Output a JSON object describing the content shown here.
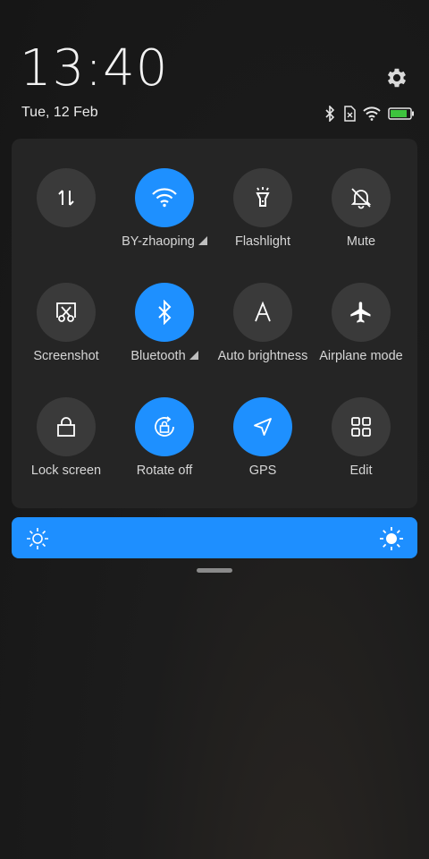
{
  "clock": {
    "time": "13:40",
    "date": "Tue, 12 Feb"
  },
  "colors": {
    "accent": "#1e90ff",
    "tile_off": "#3a3a3a",
    "panel": "#262626"
  },
  "status_icons": [
    "bluetooth-icon",
    "no-sim-icon",
    "wifi-icon",
    "battery-icon"
  ],
  "tiles": [
    {
      "label": "",
      "icon": "data-transfer-icon",
      "state": "off"
    },
    {
      "label": "BY-zhaoping",
      "icon": "wifi-icon",
      "state": "on",
      "has_menu": true
    },
    {
      "label": "Flashlight",
      "icon": "flashlight-icon",
      "state": "off"
    },
    {
      "label": "Mute",
      "icon": "bell-off-icon",
      "state": "off"
    },
    {
      "label": "Screenshot",
      "icon": "screenshot-icon",
      "state": "off"
    },
    {
      "label": "Bluetooth",
      "icon": "bluetooth-icon",
      "state": "on",
      "has_menu": true
    },
    {
      "label": "Auto brightness",
      "icon": "auto-brightness-icon",
      "state": "off"
    },
    {
      "label": "Airplane mode",
      "icon": "airplane-icon",
      "state": "off"
    },
    {
      "label": "Lock screen",
      "icon": "lock-icon",
      "state": "off"
    },
    {
      "label": "Rotate off",
      "icon": "rotate-lock-icon",
      "state": "on"
    },
    {
      "label": "GPS",
      "icon": "gps-icon",
      "state": "on"
    },
    {
      "label": "Edit",
      "icon": "edit-grid-icon",
      "state": "off"
    }
  ],
  "brightness": {
    "level": 1.0
  }
}
